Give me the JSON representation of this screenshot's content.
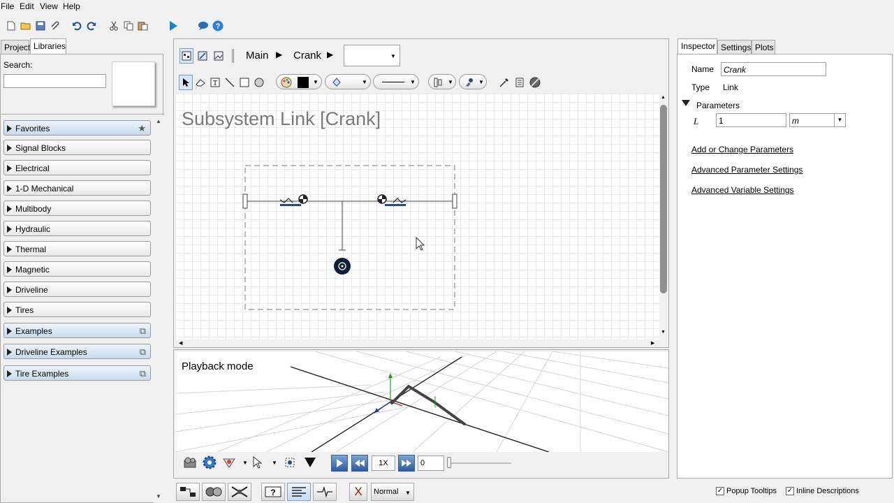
{
  "menu": {
    "file": "File",
    "edit": "Edit",
    "view": "View",
    "help": "Help"
  },
  "left": {
    "tabs": {
      "project": "Project",
      "libraries": "Libraries"
    },
    "search_label": "Search:",
    "search_value": "",
    "items": [
      {
        "label": "Favorites"
      },
      {
        "label": "Signal Blocks"
      },
      {
        "label": "Electrical"
      },
      {
        "label": "1-D Mechanical"
      },
      {
        "label": "Multibody"
      },
      {
        "label": "Hydraulic"
      },
      {
        "label": "Thermal"
      },
      {
        "label": "Magnetic"
      },
      {
        "label": "Driveline"
      },
      {
        "label": "Tires"
      },
      {
        "label": "Examples"
      },
      {
        "label": "Driveline Examples"
      },
      {
        "label": "Tire Examples"
      }
    ]
  },
  "center": {
    "breadcrumb": {
      "main": "Main",
      "crank": "Crank"
    },
    "dropdown_value": "",
    "canvas_title": "Subsystem Link [Crank]",
    "playback_label": "Playback mode",
    "speed": "1X",
    "time_value": "0",
    "normal": "Normal",
    "x_label": "X"
  },
  "right": {
    "tabs": {
      "inspector": "Inspector",
      "settings": "Settings",
      "plots": "Plots"
    },
    "name_label": "Name",
    "name_value": "Crank",
    "type_label": "Type",
    "type_value": "Link",
    "params_label": "Parameters",
    "param_symbol": "L",
    "param_value": "1",
    "param_unit": "m",
    "links": {
      "add": "Add or Change Parameters",
      "adv_param": "Advanced Parameter Settings",
      "adv_var": "Advanced Variable Settings"
    },
    "popup": "Popup Tooltips",
    "inline": "Inline Descriptions"
  }
}
